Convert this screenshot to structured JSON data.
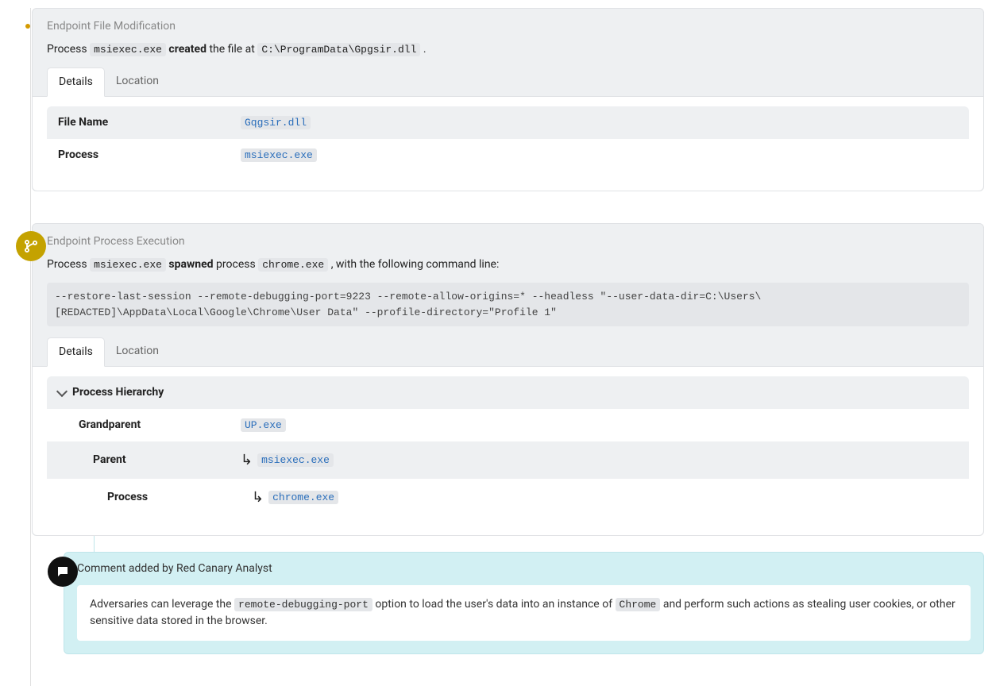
{
  "event1": {
    "title": "Endpoint File Modification",
    "desc": {
      "prefix": "Process ",
      "proc": "msiexec.exe",
      "action": "created",
      "mid": " the file at ",
      "path": "C:\\ProgramData\\Gpgsir.dll",
      "suffix": "."
    },
    "tabs": {
      "details": "Details",
      "location": "Location"
    },
    "rows": {
      "filename_label": "File Name",
      "filename_value": "Gqgsir.dll",
      "process_label": "Process",
      "process_value": "msiexec.exe"
    }
  },
  "event2": {
    "title": "Endpoint Process Execution",
    "desc": {
      "prefix": "Process ",
      "proc": "msiexec.exe",
      "action": "spawned",
      "mid": " process ",
      "target": "chrome.exe",
      "suffix": ", with the following command line:"
    },
    "command": "--restore-last-session --remote-debugging-port=9223 --remote-allow-origins=* --headless \"--user-data-dir=C:\\Users\\[REDACTED]\\AppData\\Local\\Google\\Chrome\\User Data\" --profile-directory=\"Profile 1\"",
    "tabs": {
      "details": "Details",
      "location": "Location"
    },
    "section": "Process Hierarchy",
    "rows": {
      "gp_label": "Grandparent",
      "gp_value": "UP.exe",
      "parent_label": "Parent",
      "parent_value": "msiexec.exe",
      "process_label": "Process",
      "process_value": "chrome.exe"
    }
  },
  "comment": {
    "header": "Comment added by Red Canary Analyst",
    "body": {
      "p1": "Adversaries can leverage the ",
      "code1": "remote-debugging-port",
      "p2": " option to load the user's data into an instance of ",
      "code2": "Chrome",
      "p3": " and perform such actions as stealing user cookies, or other sensitive data stored in the browser."
    }
  }
}
